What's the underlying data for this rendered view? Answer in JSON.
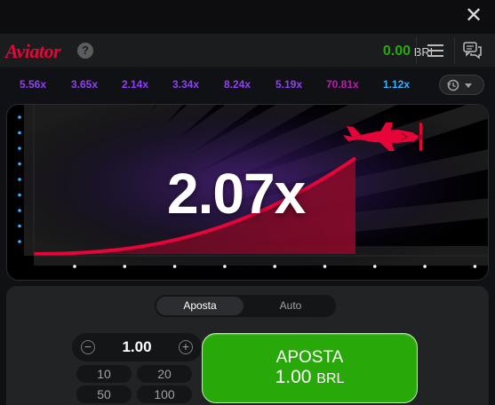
{
  "window": {
    "close_glyph": "✕"
  },
  "header": {
    "logo": "Aviator",
    "help_glyph": "?",
    "balance": "0.00",
    "currency": "BRL"
  },
  "history": {
    "multipliers": [
      {
        "value": "5.56x",
        "color": "#913ef8"
      },
      {
        "value": "3.65x",
        "color": "#913ef8"
      },
      {
        "value": "2.14x",
        "color": "#913ef8"
      },
      {
        "value": "3.34x",
        "color": "#913ef8"
      },
      {
        "value": "8.24x",
        "color": "#913ef8"
      },
      {
        "value": "5.19x",
        "color": "#913ef8"
      },
      {
        "value": "70.81x",
        "color": "#c017b4"
      },
      {
        "value": "1.12x",
        "color": "#34b4ff"
      }
    ]
  },
  "game": {
    "multiplier": "2.07x",
    "plane_color": "#e50539",
    "curve_color": "#e50539"
  },
  "bet_panel": {
    "tabs": [
      {
        "label": "Aposta",
        "active": true
      },
      {
        "label": "Auto",
        "active": false
      }
    ],
    "stake_value": "1.00",
    "minus_glyph": "−",
    "plus_glyph": "+",
    "quick_amounts": [
      "10",
      "20",
      "50",
      "100"
    ],
    "bet_button_label": "APOSTA",
    "bet_button_amount": "1.00",
    "bet_button_currency": "BRL",
    "bet_button_color": "#28a909"
  }
}
